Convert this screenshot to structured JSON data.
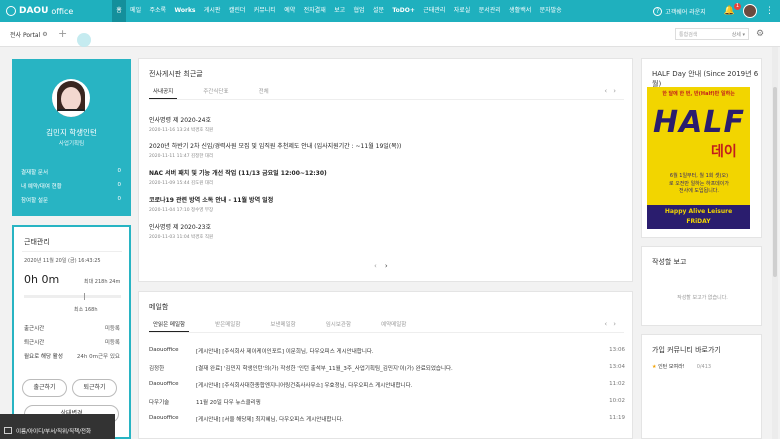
{
  "header": {
    "logo": "DAOU",
    "logo_sub": "office",
    "nav": [
      "홈",
      "메일",
      "주소록",
      "Works",
      "게시판",
      "캘린더",
      "커뮤니티",
      "예약",
      "전자결재",
      "보고",
      "협업",
      "설문",
      "ToDO+",
      "근태관리",
      "자료실",
      "문서관리",
      "생활백서",
      "문자발송"
    ],
    "user": "고객쉐어 라운지",
    "badge": "1"
  },
  "tabs": {
    "portal": "전사 Portal",
    "search_placeholder": "통합검색",
    "search_opt": "상세 ▾"
  },
  "profile": {
    "name": "김민지 학생인턴",
    "role": "사업기획팀",
    "links": [
      {
        "label": "결재할 문서",
        "count": "0"
      },
      {
        "label": "내 예약/대여 현황",
        "count": "0"
      },
      {
        "label": "참여할 설문",
        "count": "0"
      }
    ]
  },
  "attendance": {
    "title": "근태관리",
    "date": "2020년 11월 20일 (금) 16:43:25",
    "hours": "0h 0m",
    "max": "최대 218h 24m",
    "min": "최소 168h",
    "rows": [
      {
        "k": "출근시간",
        "v": "미등록"
      },
      {
        "k": "퇴근시간",
        "v": "미등록"
      },
      {
        "k": "월요로 해당 활성",
        "v": "24h 0m근무 있요"
      }
    ],
    "btn_in": "출근하기",
    "btn_out": "퇴근하기",
    "btn_status": "상태변경"
  },
  "board": {
    "title": "전사게시판 최근글",
    "tabs": [
      "사내공지",
      "주간식단표",
      "전체"
    ],
    "posts": [
      {
        "title": "인사명령 제 2020-24호",
        "meta": "2020-11-16 13:24  박경호 직원",
        "bold": false
      },
      {
        "title": "2020년 하반기 2차 신입/경력사원 모집 및 임직원 추천제도 안내 (입사지원기간 : ~11월 19일(목))",
        "meta": "2020-11-11 11:47  김정한 대리",
        "bold": false
      },
      {
        "title": "NAC 서버 패치 및 기능 개선 작업 (11/13 금요일 12:00~12:30)",
        "meta": "2020-11-09 15:44  김도원 대리",
        "bold": true
      },
      {
        "title": "코로나19 관련 방역 소독 안내 - 11월 방역 일정",
        "meta": "2020-11-04 17:10  정수영 부장",
        "bold": true
      },
      {
        "title": "인사명령 제 2020-23호",
        "meta": "2020-11-03 11:04  박경호 직원",
        "bold": false
      }
    ]
  },
  "approval": {
    "title": "메일함",
    "tabs": [
      "안읽은 메일함",
      "받은메일함",
      "보낸메일함",
      "임시보관함",
      "예약메일함"
    ],
    "rows": [
      {
        "who": "Daouoffice",
        "text": "[게시안내] [주식회사 제이케이인포트] 이문희님, 다우오피스 게시안내합니다.",
        "time": "13:06"
      },
      {
        "who": "김정한",
        "text": "[결재 완료] '김민지 학생인턴'의(가) 작성한 '인턴 출석부_11월_3주_사업기획팀_김민지'이(가) 완료되었습니다.",
        "time": "13:04"
      },
      {
        "who": "Daouoffice",
        "text": "[게시안내] [주식회사대한종합엔지니어링건축사사무소] 우효정님, 다우오피스 게시안내합니다.",
        "time": "11:02"
      },
      {
        "who": "다우기술",
        "text": "11월 20일 다우 뉴스클리핑",
        "time": "10:02"
      },
      {
        "who": "Daouoffice",
        "text": "[게시안내] [서울 해당제] 최지혜님, 다우오피스 게시안내합니다.",
        "time": "11:19"
      }
    ]
  },
  "half": {
    "title": "HALF Day 안내 (Since 2019년 6월)",
    "top": "한 달에 한 번, 반(Half)만 일하는",
    "big": "HALF",
    "day": "데이",
    "desc": "6월 1일부터, 월 1회 셋(오)로 오전만 일하는 하프데이가 전사에 도입됩니다.",
    "bottom1": "Happy Alive Leisure",
    "bottom2": "FRiDAY"
  },
  "writer": {
    "title": "작성할 보고",
    "empty": "작성할 보고가 없습니다."
  },
  "community": {
    "title": "가입 커뮤니티 바로가기",
    "item": "인턴 모여라!",
    "count": "0/413"
  },
  "tooltip": "이름/아이디/부서/직위/직책/전화"
}
